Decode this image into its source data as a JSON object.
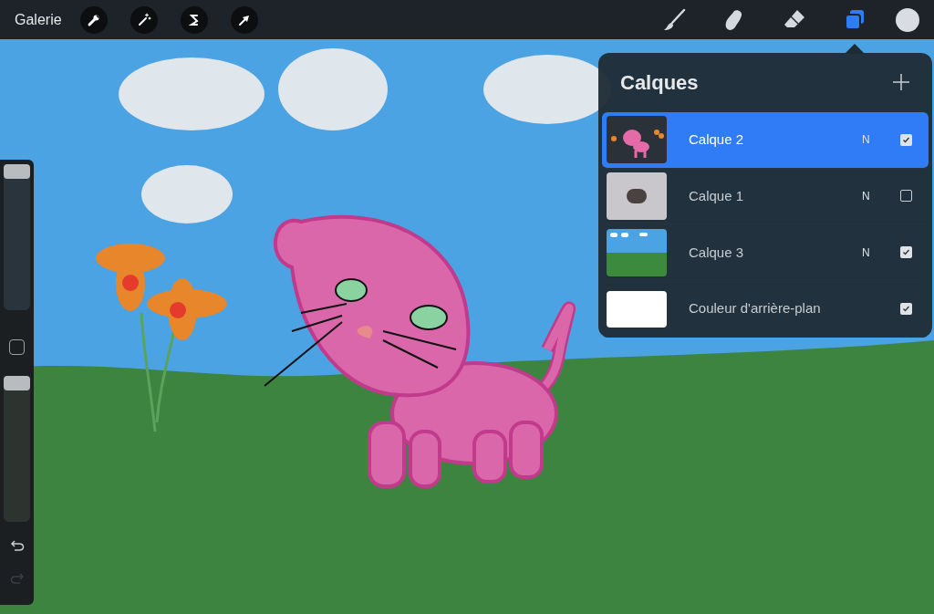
{
  "toolbar": {
    "gallery": "Galerie",
    "actions": [
      {
        "kind": "wrench"
      },
      {
        "kind": "wand"
      },
      {
        "kind": "selection"
      },
      {
        "kind": "transform"
      }
    ],
    "tools": [
      {
        "kind": "brush",
        "selected": false
      },
      {
        "kind": "smudge",
        "selected": false
      },
      {
        "kind": "eraser",
        "selected": false
      },
      {
        "kind": "layers",
        "selected": true
      }
    ],
    "color": "#d9dde2"
  },
  "sidebar": {
    "size_slider": {
      "level": 1.0
    },
    "opacity_slider": {
      "level": 1.0
    },
    "redo_disabled": true
  },
  "layers_panel": {
    "title": "Calques",
    "layers": [
      {
        "name": "Calque 2",
        "mode": "N",
        "visible": true,
        "selected": true,
        "kind": "cat"
      },
      {
        "name": "Calque 1",
        "mode": "N",
        "visible": false,
        "selected": false,
        "kind": "photo"
      },
      {
        "name": "Calque 3",
        "mode": "N",
        "visible": true,
        "selected": false,
        "kind": "landscape"
      },
      {
        "name": "Couleur d'arrière-plan",
        "visible": true,
        "selected": false,
        "kind": "blank"
      }
    ]
  }
}
